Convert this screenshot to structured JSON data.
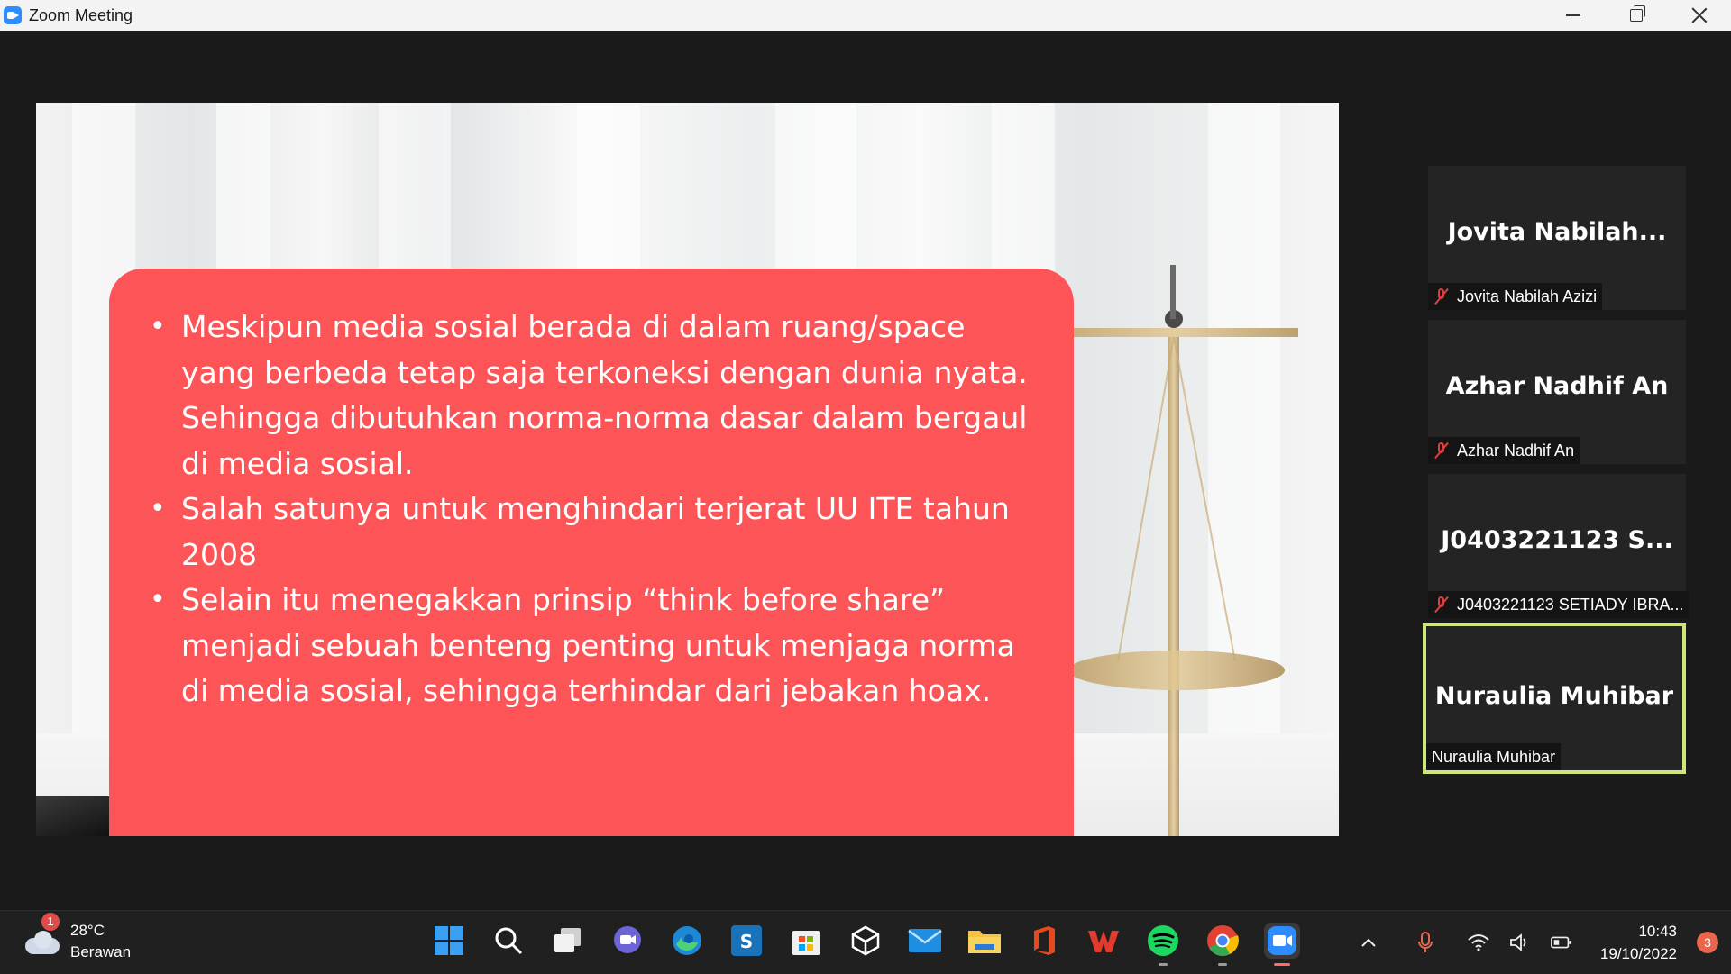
{
  "window": {
    "title": "Zoom Meeting"
  },
  "slide": {
    "bullets": [
      "Meskipun media sosial berada di dalam ruang/space yang berbeda tetap saja terkoneksi dengan dunia nyata. Sehingga dibutuhkan norma-norma dasar dalam bergaul di media sosial.",
      "Salah satunya untuk menghindari terjerat UU ITE tahun 2008",
      "Selain itu menegakkan prinsip “think before share” menjadi sebuah benteng penting untuk menjaga norma di media sosial, sehingga terhindar dari jebakan hoax."
    ]
  },
  "participants": [
    {
      "display": "Jovita  Nabilah...",
      "label": "Jovita Nabilah Azizi",
      "muted": true
    },
    {
      "display": "Azhar Nadhif An",
      "label": "Azhar Nadhif An",
      "muted": true
    },
    {
      "display": "J0403221123  S...",
      "label": "J0403221123 SETIADY IBRA...",
      "muted": true
    },
    {
      "display": "Nuraulia Muhibar",
      "label": "Nuraulia Muhibar",
      "muted": false,
      "active_speaker": true
    }
  ],
  "taskbar": {
    "weather": {
      "temp": "28°C",
      "condition": "Berawan",
      "badge": "1"
    },
    "apps": [
      "start-icon",
      "search-icon",
      "task-view-icon",
      "teams-chat-icon",
      "edge-icon",
      "skype-icon",
      "store-icon",
      "dev-cube-icon",
      "mail-icon",
      "file-explorer-icon",
      "office-icon",
      "wps-icon",
      "spotify-icon",
      "chrome-icon",
      "zoom-icon"
    ],
    "clock": {
      "time": "10:43",
      "date": "19/10/2022"
    },
    "notifications": "3"
  },
  "colors": {
    "slide_box": "#fd5557",
    "active_border": "#cfe67a",
    "zoom_blue": "#2d8cff",
    "muted_red": "#e03e3e"
  }
}
